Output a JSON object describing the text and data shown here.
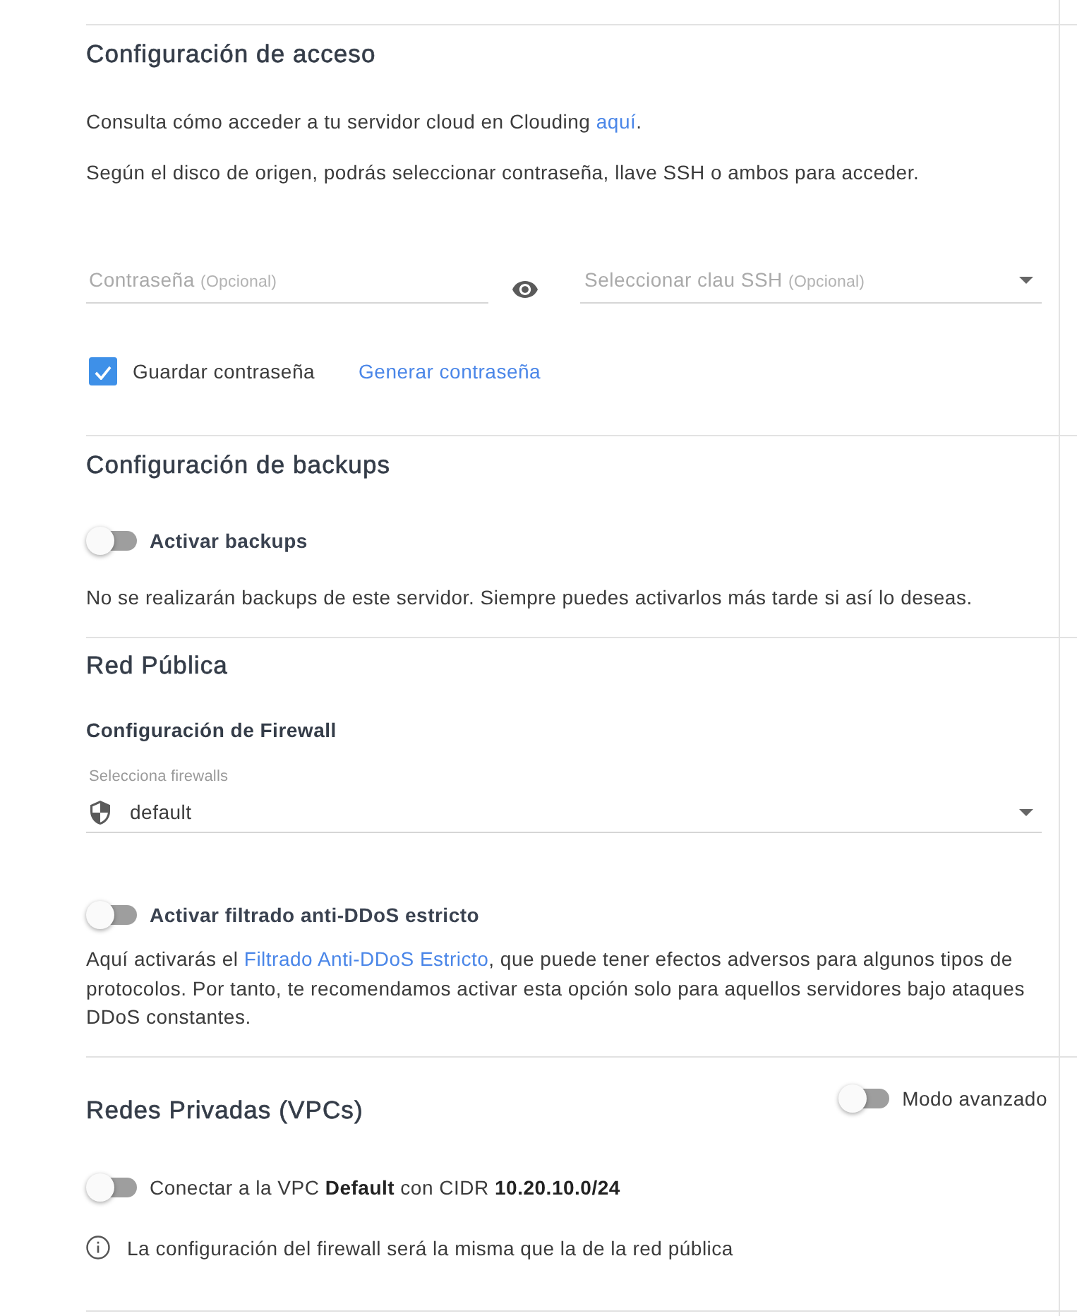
{
  "access": {
    "title": "Configuración de acceso",
    "help_text": [
      {
        "kind": "text",
        "text": "Consulta cómo acceder a tu servidor cloud en Clouding "
      },
      {
        "kind": "link",
        "text": "aquí"
      },
      {
        "kind": "text",
        "text": "."
      }
    ],
    "description": "Según el disco de origen, podrás seleccionar contraseña, llave SSH o ambos para acceder.",
    "password_field": {
      "placeholder": "Contraseña",
      "placeholder_note": "(Opcional)"
    },
    "ssh_key_select": {
      "placeholder": "Seleccionar clau SSH",
      "placeholder_note": "(Opcional)"
    },
    "save_password": {
      "label": "Guardar contraseña",
      "checked": true
    },
    "generate_link": "Generar contraseña"
  },
  "backups": {
    "title": "Configuración de backups",
    "toggle": {
      "label": "Activar backups",
      "on": false
    },
    "note": "No se realizarán backups de este servidor. Siempre puedes activarlos más tarde si así lo deseas."
  },
  "public_network": {
    "title": "Red Pública",
    "firewall": {
      "title": "Configuración de Firewall",
      "select": {
        "label": "Selecciona firewalls",
        "value": "default"
      }
    },
    "anti_ddos": {
      "toggle": {
        "label": "Activar filtrado anti-DDoS estricto",
        "on": false
      },
      "description": [
        {
          "kind": "text",
          "text": "Aquí activarás el "
        },
        {
          "kind": "link",
          "text": "Filtrado Anti-DDoS Estricto"
        },
        {
          "kind": "text",
          "text": ", que puede tener efectos adversos para algunos tipos de protocolos. Por tanto, te recomendamos activar esta opción solo para aquellos servidores bajo ataques DDoS constantes."
        }
      ]
    }
  },
  "private_networks": {
    "title": "Redes Privadas (VPCs)",
    "advanced_mode": {
      "label": "Modo avanzado",
      "on": false
    },
    "vpc_toggle": {
      "label": "Conectar a la VPC **Default** con CIDR **10.20.10.0/24**",
      "on": false
    },
    "info": "La configuración del firewall será la misma que la de la red pública"
  }
}
